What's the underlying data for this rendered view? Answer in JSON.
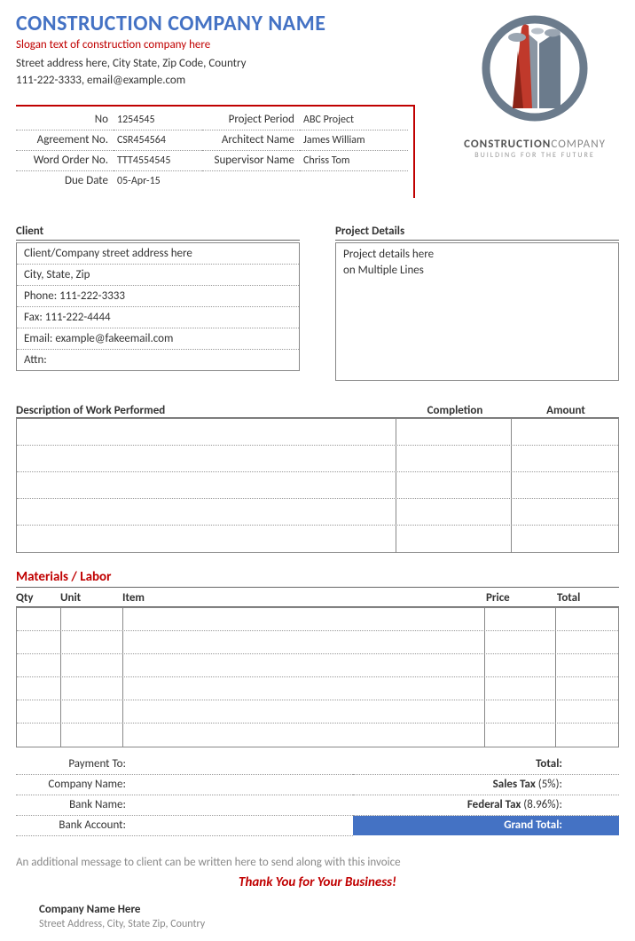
{
  "header": {
    "company_name": "CONSTRUCTION COMPANY NAME",
    "slogan": "Slogan text of construction company here",
    "address": "Street address here, City State, Zip Code, Country",
    "contact": "111-222-3333, email@example.com"
  },
  "logo": {
    "text_bold": "CONSTRUCTION",
    "text_light": "COMPANY",
    "tagline": "BUILDING FOR THE FUTURE"
  },
  "meta": {
    "no_label": "No",
    "no_value": "1254545",
    "period_label": "Project Period",
    "period_value": "ABC Project",
    "agreement_label": "Agreement No.",
    "agreement_value": "CSR454564",
    "architect_label": "Architect Name",
    "architect_value": "James William",
    "wordorder_label": "Word Order No.",
    "wordorder_value": "TTT4554545",
    "supervisor_label": "Supervisor Name",
    "supervisor_value": "Chriss Tom",
    "due_label": "Due Date",
    "due_value": "05-Apr-15"
  },
  "client": {
    "title": "Client",
    "line1": "Client/Company street address here",
    "line2": "City, State, Zip",
    "line3": "Phone: 111-222-3333",
    "line4": "Fax: 111-222-4444",
    "line5": "Email: example@fakeemail.com",
    "line6": "Attn:"
  },
  "project": {
    "title": "Project Details",
    "line1": "Project details here",
    "line2": "on Multiple Lines"
  },
  "work": {
    "desc_header": "Description of Work Performed",
    "completion_header": "Completion",
    "amount_header": "Amount"
  },
  "materials": {
    "title": "Materials / Labor",
    "qty": "Qty",
    "unit": "Unit",
    "item": "Item",
    "price": "Price",
    "total": "Total"
  },
  "payment": {
    "to": "Payment To:",
    "company": "Company Name:",
    "bank": "Bank Name:",
    "account": "Bank Account:"
  },
  "totals": {
    "total": "Total:",
    "sales_tax_label": "Sales Tax",
    "sales_tax_rate": " (5%):",
    "federal_tax_label": "Federal Tax",
    "federal_tax_rate": " (8.96%):",
    "grand": "Grand Total:"
  },
  "footer": {
    "msg": "An additional message to client can be written here to send along with this invoice",
    "thanks": "Thank You for Your Business!",
    "company": "Company Name Here",
    "address": "Street Address, City, State Zip, Country"
  }
}
